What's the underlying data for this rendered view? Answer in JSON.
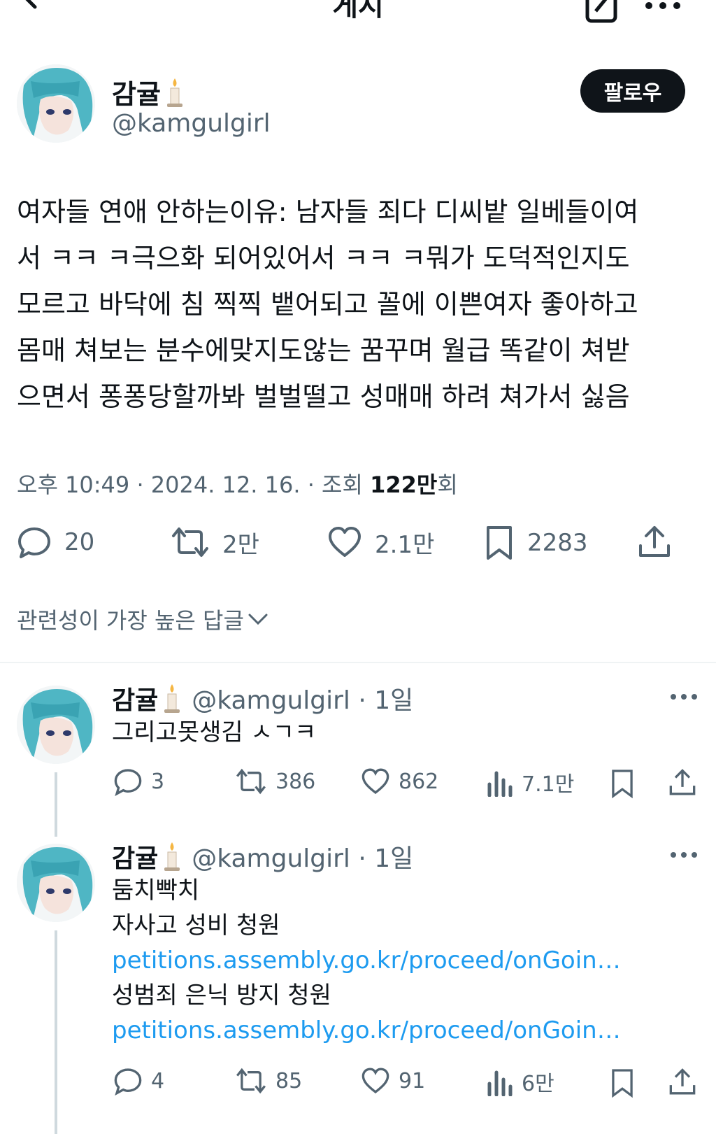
{
  "header": {
    "title": "게시",
    "back_icon": "back-arrow-icon",
    "compose_icon": "compose-icon",
    "more_icon": "more-dots-icon"
  },
  "main_post": {
    "author_name": "감귤",
    "author_handle": "@kamgulgirl",
    "follow_label": "팔로우",
    "text_lines": [
      "여자들 연애 안하는이유: 남자들 죄다 디씨밭 일베들이여",
      "서 ㅋㅋ ㅋ극으화 되어있어서 ㅋㅋ ㅋ뭐가 도덕적인지도",
      "모르고 바닥에 침 찍찍 뱉어되고 꼴에 이쁜여자 좋아하고",
      "몸매 쳐보는 분수에맞지도않는 꿈꾸며 월급 똑같이 쳐받",
      "으면서 퐁퐁당할까봐 벌벌떨고 성매매 하려 쳐가서 싫음"
    ],
    "time": "오후 10:49",
    "date": "2024. 12. 16.",
    "views_label": "조회",
    "views_value": "122만",
    "views_suffix": "회",
    "stats": {
      "replies": "20",
      "retweets": "2만",
      "likes": "2.1만",
      "bookmarks": "2283"
    }
  },
  "sort_label": "관련성이 가장 높은 답글",
  "replies": [
    {
      "author_name": "감귤",
      "author_handle": "@kamgulgirl · 1일",
      "lines": [
        "그리고못생김 ㅅㄱㅋ"
      ],
      "stats": {
        "replies": "3",
        "retweets": "386",
        "likes": "862",
        "views": "7.1만"
      }
    },
    {
      "author_name": "감귤",
      "author_handle": "@kamgulgirl · 1일",
      "lines": [
        "둠치빡치",
        "자사고 성비 청원",
        "petitions.assembly.go.kr/proceed/onGoin…",
        "성범죄 은닉 방지 청원",
        "petitions.assembly.go.kr/proceed/onGoin…"
      ],
      "stats": {
        "replies": "4",
        "retweets": "85",
        "likes": "91",
        "views": "6만"
      }
    }
  ],
  "colors": {
    "text": "#0f1419",
    "secondary": "#536471",
    "link": "#1d9bf0",
    "button": "#0f1419"
  }
}
